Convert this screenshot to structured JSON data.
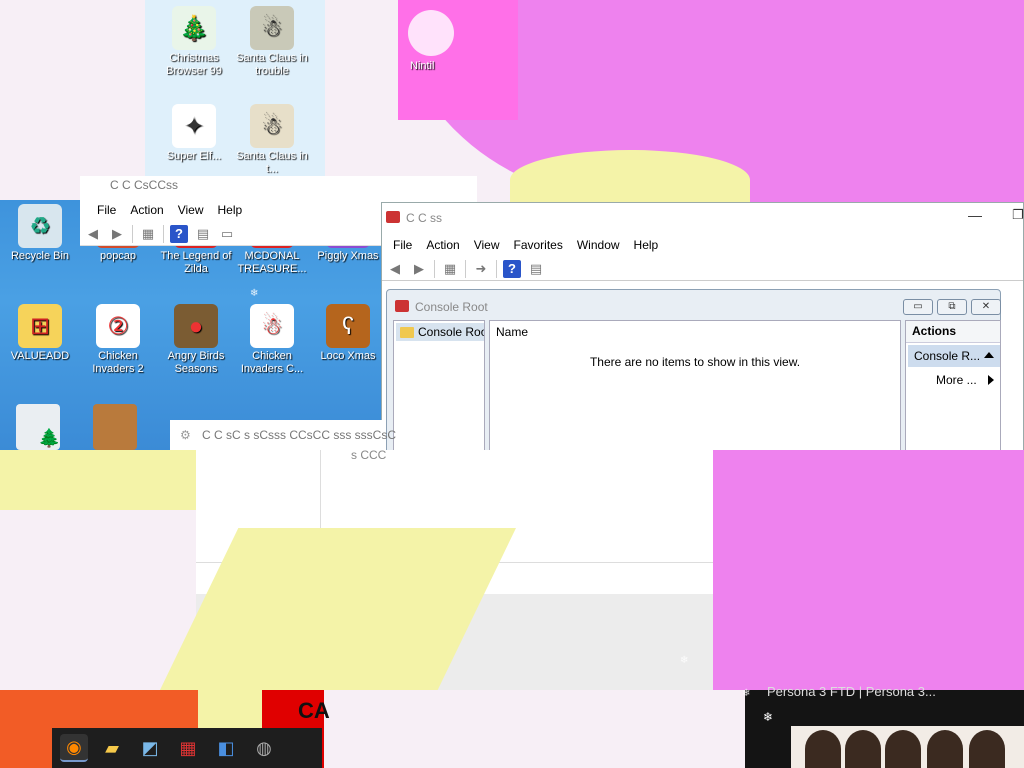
{
  "desktop": {
    "top_icons": [
      {
        "label": "Christmas Browser 99",
        "icon": "christmas-tree-icon",
        "color": "#2e9d3a"
      },
      {
        "label": "Santa Claus in trouble",
        "icon": "santa-icon",
        "color": "#c9c9b8"
      },
      {
        "label": "Super Elf...",
        "icon": "elf-icon",
        "color": "#ffffff"
      },
      {
        "label": "Santa Claus in t...",
        "icon": "santa-icon",
        "color": "#e7dfc9"
      }
    ],
    "icons_row1": [
      {
        "label": "Recycle Bin",
        "icon": "recycle-bin-icon",
        "color": "#d8e6ee"
      },
      {
        "label": "popcap",
        "icon": "popcap-icon",
        "color": "#d24b2b"
      },
      {
        "label": "The Legend of Zilda",
        "icon": "legend-icon",
        "color": "#d22"
      },
      {
        "label": "MCDONAL TREASURE...",
        "icon": "mcdonald-icon",
        "color": "#d22"
      },
      {
        "label": "Piggly Xmas",
        "icon": "piggly-icon",
        "color": "#8c4bd2"
      }
    ],
    "icons_row2": [
      {
        "label": "VALUEADD",
        "icon": "windows-folder-icon",
        "color": "#f6d35a"
      },
      {
        "label": "Chicken Invaders 2",
        "icon": "chicken-icon",
        "color": "#e33"
      },
      {
        "label": "Angry Birds Seasons",
        "icon": "angry-birds-icon",
        "color": "#7b5c33"
      },
      {
        "label": "Chicken Invaders C...",
        "icon": "snowman-icon",
        "color": "#e33"
      },
      {
        "label": "Loco Xmas",
        "icon": "bear-icon",
        "color": "#b5651d"
      }
    ],
    "faded_label": "Nintil"
  },
  "window_small": {
    "title": "C C CsCCss",
    "menu": [
      "File",
      "Action",
      "View",
      "Help"
    ]
  },
  "mmc": {
    "title": "C C ss",
    "menu": [
      "File",
      "Action",
      "View",
      "Favorites",
      "Window",
      "Help"
    ],
    "console": {
      "title": "Console Root",
      "tree_item": "Console Root",
      "list_header": "Name",
      "empty_message": "There are no items to show in this view.",
      "actions_header": "Actions",
      "actions_subheader": "Console R...",
      "actions_more": "More ..."
    }
  },
  "window_third": {
    "title": "C C sC s  sCsss  CCsCC sss sssCsC",
    "path": "s CCC"
  },
  "taskbar": {
    "items": [
      "firefox-icon",
      "file-explorer-icon",
      "notepad-icon",
      "toolbox-icon",
      "network-icon",
      "app-icon"
    ]
  },
  "video": {
    "title": "Persona 3 FTD | Persona 3..."
  },
  "bottom_red_text": "CA"
}
